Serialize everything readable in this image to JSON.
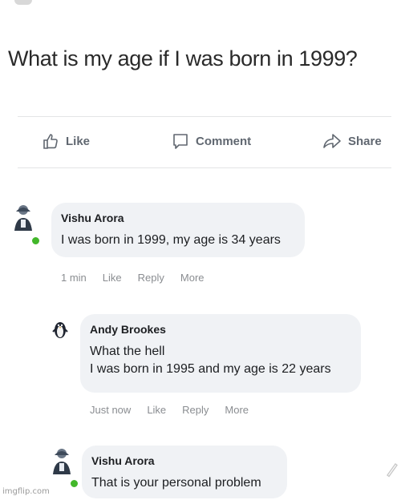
{
  "post": {
    "text": "What is my age if I was born in 1999?"
  },
  "actions": {
    "like": "Like",
    "comment": "Comment",
    "share": "Share"
  },
  "comments": [
    {
      "name": "Vishu Arora",
      "text_lines": [
        "I was born in 1999, my age is 34 years"
      ],
      "time": "1 min",
      "like": "Like",
      "reply": "Reply",
      "more": "More"
    },
    {
      "name": "Andy Brookes",
      "text_lines": [
        "What the hell",
        "I was born in 1995 and my age is 22 years"
      ],
      "time": "Just now",
      "like": "Like",
      "reply": "Reply",
      "more": "More"
    },
    {
      "name": "Vishu Arora",
      "text_lines": [
        "That is your personal problem"
      ]
    }
  ],
  "watermark": "imgflip.com",
  "colors": {
    "online": "#42b72a",
    "bubble": "#f0f2f5",
    "meta": "#8a8d91"
  }
}
